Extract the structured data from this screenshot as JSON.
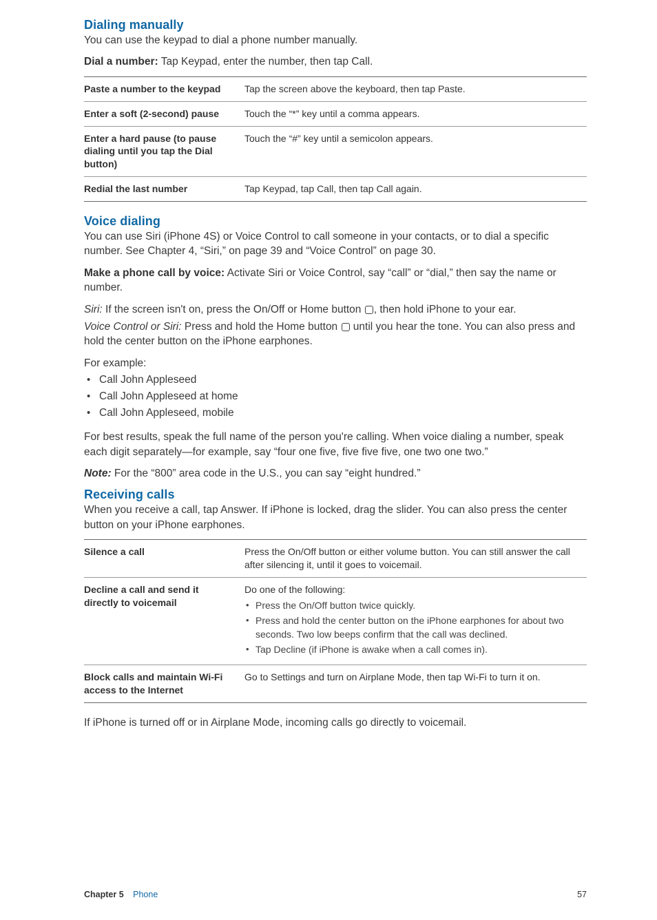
{
  "sections": {
    "dialing": {
      "heading": "Dialing manually",
      "intro": "You can use the keypad to dial a phone number manually.",
      "instruction_label": "Dial a number:",
      "instruction_text": "  Tap Keypad, enter the number, then tap Call.",
      "table": [
        {
          "label": "Paste a number to the keypad",
          "value": "Tap the screen above the keyboard, then tap Paste."
        },
        {
          "label": "Enter a soft (2-second) pause",
          "value": "Touch the “*” key until a comma appears."
        },
        {
          "label": "Enter a hard pause (to pause dialing until you tap the Dial button)",
          "value": "Touch the “#” key until a semicolon appears."
        },
        {
          "label": "Redial the last number",
          "value": "Tap Keypad, tap Call, then tap Call again."
        }
      ]
    },
    "voice": {
      "heading": "Voice dialing",
      "intro": "You can use Siri (iPhone 4S) or Voice Control to call someone in your contacts, or to dial a specific number. See Chapter 4, “Siri,” on page 39 and “Voice Control” on page 30.",
      "make_call_label": "Make a phone call by voice:",
      "make_call_text": "  Activate Siri or Voice Control, say “call” or “dial,” then say the name or number.",
      "siri_label": "Siri:",
      "siri_text_before": "  If the screen isn't on, press the On/Off or Home button ",
      "siri_text_after": ", then hold iPhone to your ear.",
      "vc_label": "Voice Control or Siri:  ",
      "vc_text_before": " Press and hold the Home button ",
      "vc_text_after": " until you hear the tone. You can also press and hold the center button on the iPhone earphones.",
      "example_label": "For example:",
      "examples": [
        "Call John Appleseed",
        "Call John Appleseed at home",
        "Call John Appleseed, mobile"
      ],
      "best_results": "For best results, speak the full name of the person you're calling. When voice dialing a number, speak each digit separately—for example, say “four one five, five five five, one two one two.”",
      "note_label": "Note:",
      "note_text": "  For the “800” area code in the U.S., you can say “eight hundred.”"
    },
    "receiving": {
      "heading": "Receiving calls",
      "intro": "When you receive a call, tap Answer. If iPhone is locked, drag the slider. You can also press the center button on your iPhone earphones.",
      "table": {
        "silence": {
          "label": "Silence a call",
          "value": "Press the On/Off button or either volume button. You can still answer the call after silencing it, until it goes to voicemail."
        },
        "decline": {
          "label": "Decline a call and send it directly to voicemail",
          "intro": "Do one of the following:",
          "bullets": [
            "Press the On/Off button twice quickly.",
            "Press and hold the center button on the iPhone earphones for about two seconds. Two low beeps confirm that the call was declined.",
            "Tap Decline (if iPhone is awake when a call comes in)."
          ]
        },
        "block": {
          "label": "Block calls and maintain Wi-Fi access to the Internet",
          "value": "Go to Settings and turn on Airplane Mode, then tap Wi-Fi to turn it on."
        }
      },
      "after": "If iPhone is turned off or in Airplane Mode, incoming calls go directly to voicemail."
    }
  },
  "footer": {
    "chapter_label": "Chapter 5",
    "chapter_name": "Phone",
    "page": "57"
  }
}
